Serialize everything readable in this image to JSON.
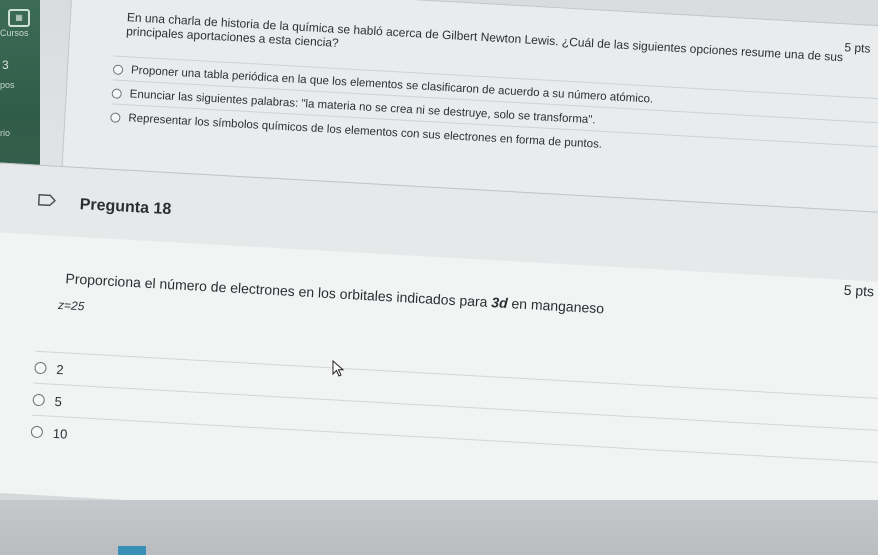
{
  "sidebar": {
    "labels": [
      "Cursos",
      "3",
      "pos",
      "rio"
    ]
  },
  "previous_question": {
    "text": "En una charla de historia de la química se habló acerca de Gilbert Newton Lewis. ¿Cuál de las siguientes opciones resume una de sus principales aportaciones a esta ciencia?",
    "points": "5 pts",
    "options": [
      "Proponer una tabla periódica en la que los elementos se clasificaron de acuerdo a su número atómico.",
      "Enunciar las siguientes palabras: \"la materia no se crea ni se destruye, solo se transforma\".",
      "Representar los símbolos químicos de los elementos con sus electrones en forma de puntos."
    ]
  },
  "question": {
    "title": "Pregunta 18",
    "points": "5 pts",
    "text_before": "Proporciona el número de electrones en los orbitales indicados para ",
    "orbital": "3d",
    "text_after": " en manganeso",
    "z_value": "z=25",
    "answers": [
      "2",
      "5",
      "10"
    ]
  },
  "colors": {
    "nav": "#2f5c48",
    "accent": "#3a8fb7"
  }
}
